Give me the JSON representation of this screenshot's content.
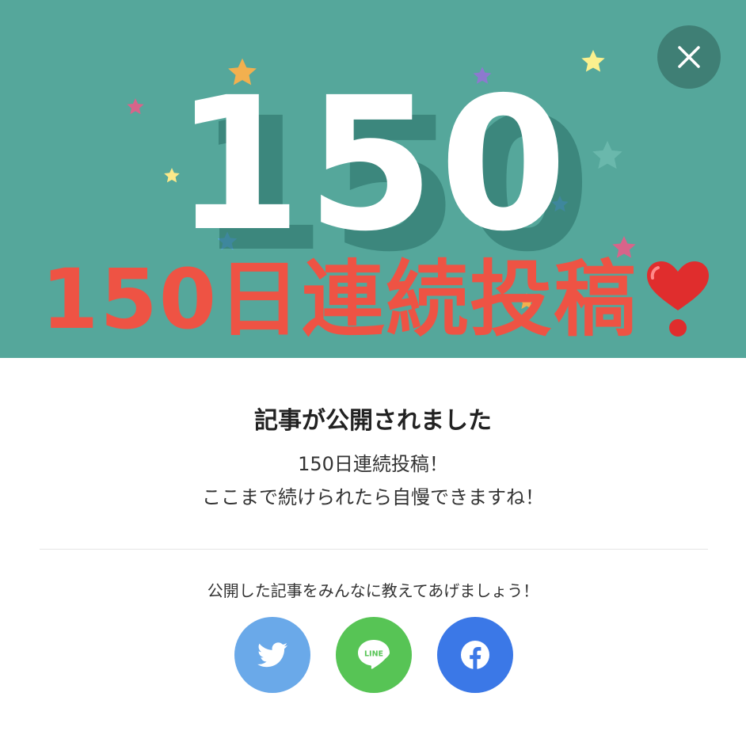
{
  "banner": {
    "big_number": "150",
    "headline": "150日連続投稿",
    "background_color": "#55a79b",
    "headline_color": "#ee5344",
    "heart_icon": "heart-exclamation-icon"
  },
  "close_button": {
    "icon": "close-icon"
  },
  "dialog": {
    "title": "記事が公開されました",
    "message_line1": "150日連続投稿！",
    "message_line2": "ここまで続けられたら自慢できますね！",
    "share_prompt": "公開した記事をみんなに教えてあげましょう！"
  },
  "share_buttons": [
    {
      "name": "twitter",
      "icon": "twitter-bird-icon",
      "color": "#6aa9e9"
    },
    {
      "name": "line",
      "icon": "line-logo-icon",
      "label": "LINE",
      "color": "#57c455"
    },
    {
      "name": "facebook",
      "icon": "facebook-f-icon",
      "color": "#3b78e7"
    }
  ]
}
